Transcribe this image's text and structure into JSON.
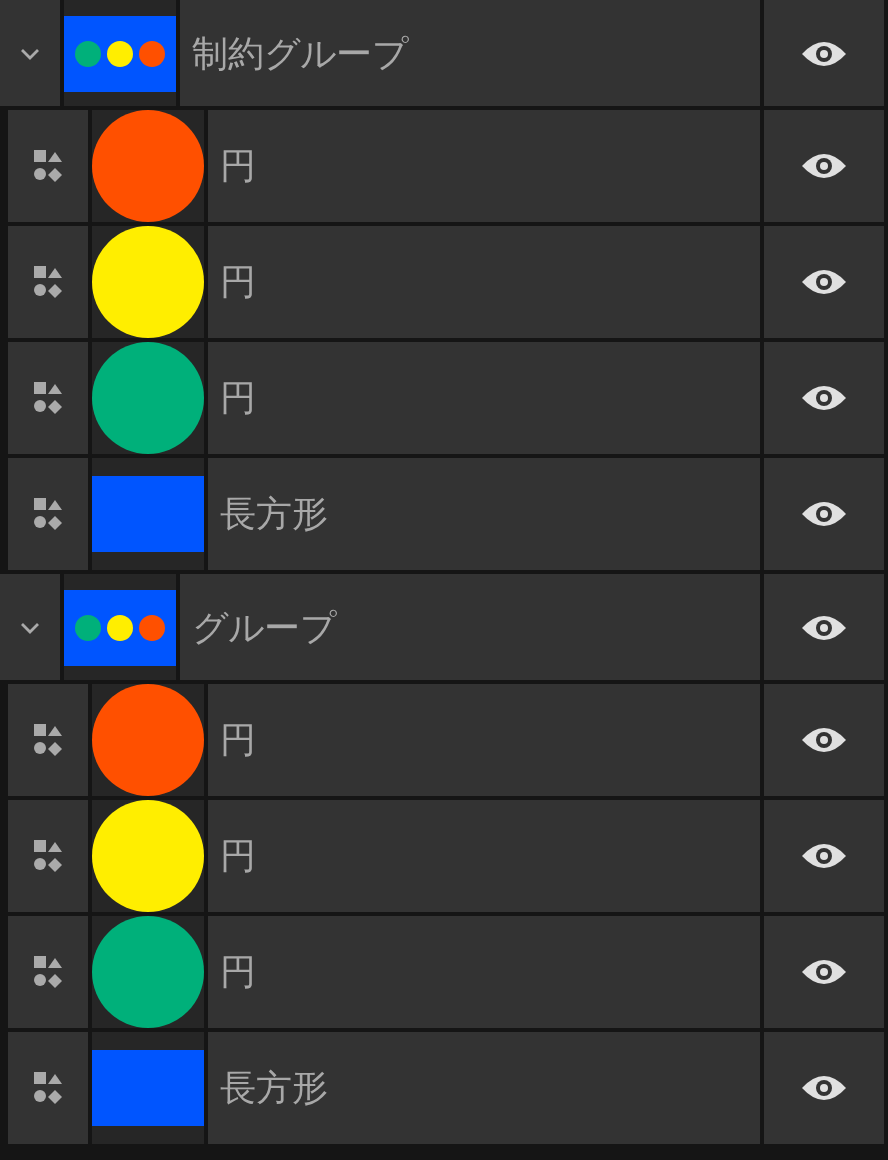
{
  "groups": [
    {
      "name": "制約グループ",
      "expanded": true,
      "visible": true,
      "children": [
        {
          "name": "円",
          "kind": "circle",
          "color": "#ff5000",
          "visible": true
        },
        {
          "name": "円",
          "kind": "circle",
          "color": "#ffee00",
          "visible": true
        },
        {
          "name": "円",
          "kind": "circle",
          "color": "#00b07a",
          "visible": true
        },
        {
          "name": "長方形",
          "kind": "rect",
          "color": "#0055ff",
          "visible": true
        }
      ]
    },
    {
      "name": "グループ",
      "expanded": true,
      "visible": true,
      "children": [
        {
          "name": "円",
          "kind": "circle",
          "color": "#ff5000",
          "visible": true
        },
        {
          "name": "円",
          "kind": "circle",
          "color": "#ffee00",
          "visible": true
        },
        {
          "name": "円",
          "kind": "circle",
          "color": "#00b07a",
          "visible": true
        },
        {
          "name": "長方形",
          "kind": "rect",
          "color": "#0055ff",
          "visible": true
        }
      ]
    }
  ]
}
